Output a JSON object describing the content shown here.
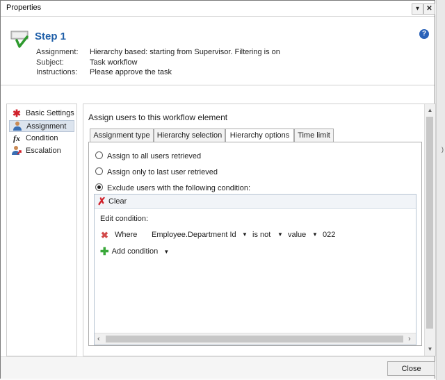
{
  "window": {
    "title": "Properties"
  },
  "header": {
    "step_title": "Step 1",
    "rows": [
      {
        "label": "Assignment:",
        "value": "Hierarchy based: starting from Supervisor. Filtering is on"
      },
      {
        "label": "Subject:",
        "value": "Task workflow"
      },
      {
        "label": "Instructions:",
        "value": "Please approve the task"
      }
    ]
  },
  "nav": {
    "items": [
      {
        "label": "Basic Settings",
        "icon": "asterisk-icon",
        "active": false
      },
      {
        "label": "Assignment",
        "icon": "user-icon",
        "active": true
      },
      {
        "label": "Condition",
        "icon": "fx-icon",
        "active": false
      },
      {
        "label": "Escalation",
        "icon": "escalation-icon",
        "active": false
      }
    ]
  },
  "content": {
    "title": "Assign users to this workflow element",
    "tabs": [
      {
        "label": "Assignment type"
      },
      {
        "label": "Hierarchy selection"
      },
      {
        "label": "Hierarchy options",
        "active": true
      },
      {
        "label": "Time limit"
      }
    ],
    "options": [
      {
        "label": "Assign to all users retrieved",
        "selected": false
      },
      {
        "label": "Assign only to last user retrieved",
        "selected": false
      },
      {
        "label": "Exclude users with the following condition:",
        "selected": true
      }
    ],
    "condition": {
      "clear_label": "Clear",
      "edit_label": "Edit condition:",
      "where": "Where",
      "field": "Employee.Department Id",
      "operator": "is not",
      "value_type": "value",
      "value": "022",
      "add_label": "Add condition"
    }
  },
  "footer": {
    "close_label": "Close"
  },
  "colors": {
    "accent": "#1f5fa8",
    "delete": "#d0202a",
    "add": "#3aa83a"
  }
}
